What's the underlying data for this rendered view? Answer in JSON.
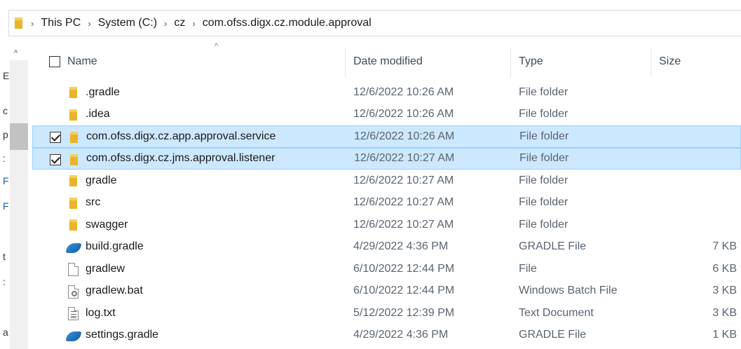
{
  "address": {
    "crumbs": [
      "This PC",
      "System (C:)",
      "cz",
      "com.ofss.digx.cz.module.approval"
    ],
    "separator": "›"
  },
  "leftpane": {
    "truncated": [
      "E",
      "c",
      "p",
      ":",
      "F",
      "F",
      "t",
      ":",
      "a"
    ]
  },
  "columns": {
    "name": "Name",
    "date": "Date modified",
    "type": "Type",
    "size": "Size"
  },
  "files": [
    {
      "name": ".gradle",
      "date": "12/6/2022 10:26 AM",
      "type": "File folder",
      "size": "",
      "icon": "folder-icon",
      "selected": false
    },
    {
      "name": ".idea",
      "date": "12/6/2022 10:26 AM",
      "type": "File folder",
      "size": "",
      "icon": "folder-icon",
      "selected": false
    },
    {
      "name": "com.ofss.digx.cz.app.approval.service",
      "date": "12/6/2022 10:26 AM",
      "type": "File folder",
      "size": "",
      "icon": "folder-icon",
      "selected": true
    },
    {
      "name": "com.ofss.digx.cz.jms.approval.listener",
      "date": "12/6/2022 10:27 AM",
      "type": "File folder",
      "size": "",
      "icon": "folder-icon",
      "selected": true
    },
    {
      "name": "gradle",
      "date": "12/6/2022 10:27 AM",
      "type": "File folder",
      "size": "",
      "icon": "folder-icon",
      "selected": false
    },
    {
      "name": "src",
      "date": "12/6/2022 10:27 AM",
      "type": "File folder",
      "size": "",
      "icon": "folder-icon",
      "selected": false
    },
    {
      "name": "swagger",
      "date": "12/6/2022 10:27 AM",
      "type": "File folder",
      "size": "",
      "icon": "folder-icon",
      "selected": false
    },
    {
      "name": "build.gradle",
      "date": "4/29/2022 4:36 PM",
      "type": "GRADLE File",
      "size": "7 KB",
      "icon": "gradle-file-icon",
      "selected": false
    },
    {
      "name": "gradlew",
      "date": "6/10/2022 12:44 PM",
      "type": "File",
      "size": "6 KB",
      "icon": "file-icon",
      "selected": false
    },
    {
      "name": "gradlew.bat",
      "date": "6/10/2022 12:44 PM",
      "type": "Windows Batch File",
      "size": "3 KB",
      "icon": "batch-file-icon",
      "selected": false
    },
    {
      "name": "log.txt",
      "date": "5/12/2022 12:39 PM",
      "type": "Text Document",
      "size": "3 KB",
      "icon": "text-file-icon",
      "selected": false
    },
    {
      "name": "settings.gradle",
      "date": "4/29/2022 4:36 PM",
      "type": "GRADLE File",
      "size": "1 KB",
      "icon": "gradle-file-icon",
      "selected": false
    }
  ],
  "colors": {
    "selection_bg": "#cce8ff",
    "selection_border": "#99d1ff",
    "folder": "#e8b52a"
  }
}
